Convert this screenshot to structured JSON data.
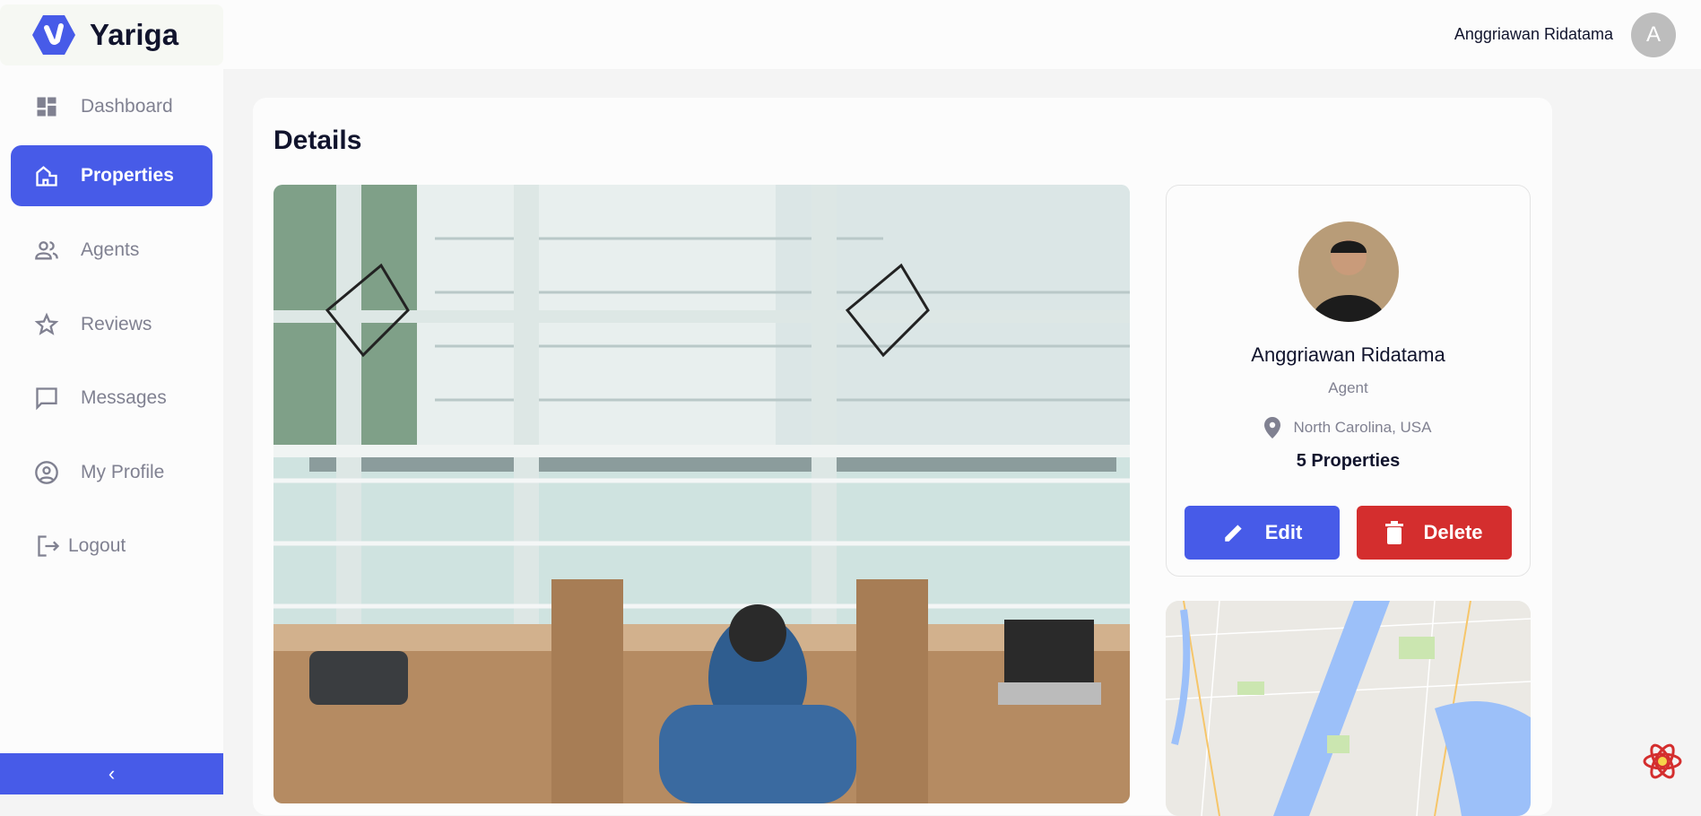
{
  "brand": {
    "name": "Yariga",
    "color": "#475be8"
  },
  "sidebar": {
    "items": [
      {
        "label": "Dashboard",
        "icon": "dashboard-icon",
        "active": false
      },
      {
        "label": "Properties",
        "icon": "properties-icon",
        "active": true
      },
      {
        "label": "Agents",
        "icon": "people-icon",
        "active": false
      },
      {
        "label": "Reviews",
        "icon": "star-icon",
        "active": false
      },
      {
        "label": "Messages",
        "icon": "chat-icon",
        "active": false
      },
      {
        "label": "My Profile",
        "icon": "account-circle-icon",
        "active": false
      },
      {
        "label": "Logout",
        "icon": "logout-icon",
        "active": false
      }
    ],
    "collapse_icon": "chevron-left-icon"
  },
  "header": {
    "user_name": "Anggriawan Ridatama",
    "avatar_letter": "A"
  },
  "page": {
    "title": "Details"
  },
  "agent": {
    "name": "Anggriawan Ridatama",
    "role": "Agent",
    "location": "North Carolina, USA",
    "properties": "5 Properties",
    "edit_label": "Edit",
    "delete_label": "Delete",
    "edit_color": "#475be8",
    "delete_color": "#d42e2e"
  }
}
